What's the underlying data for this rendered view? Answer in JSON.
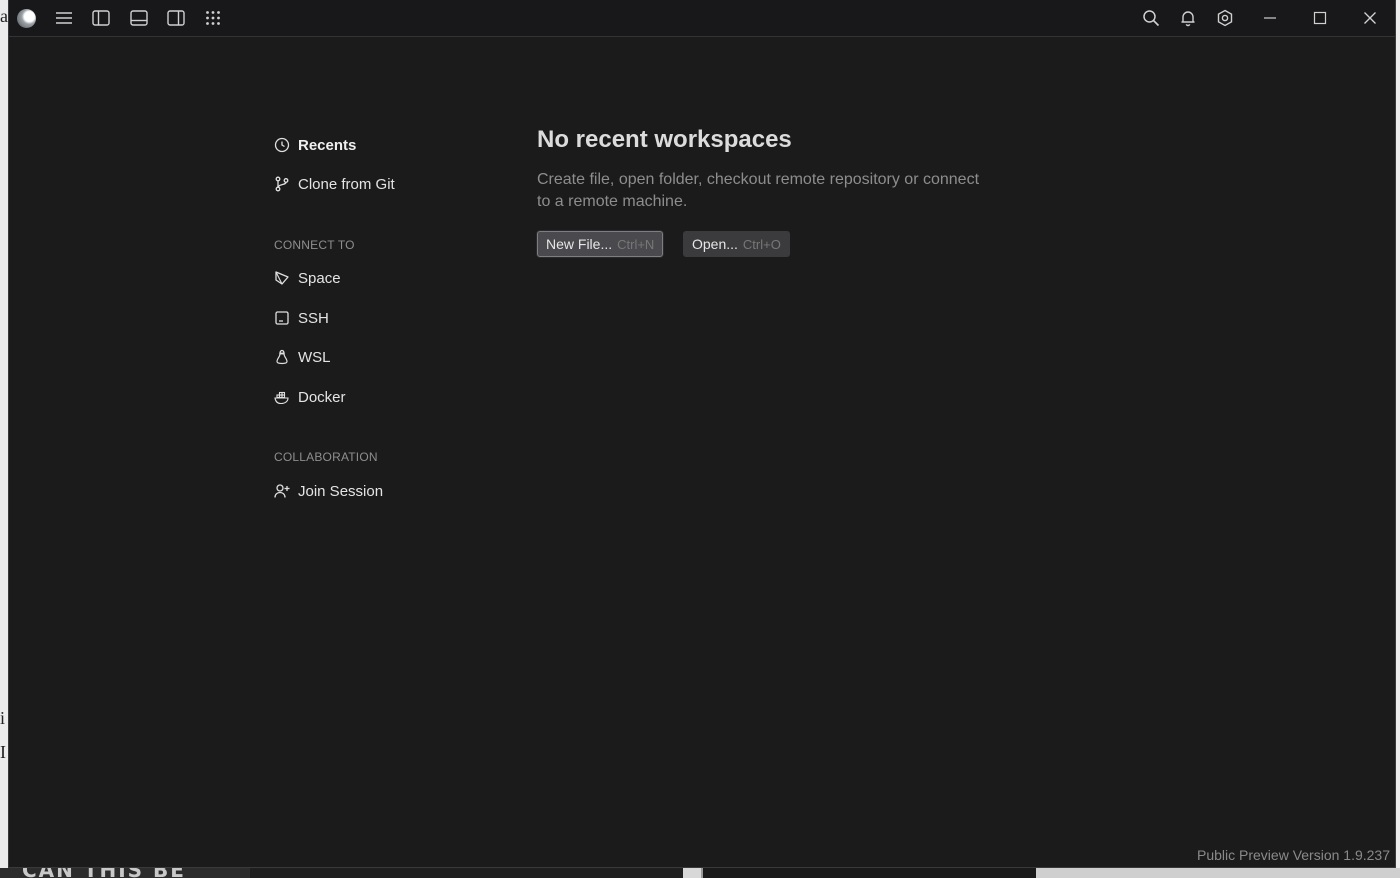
{
  "background": {
    "left_glyphs": [
      "a",
      "i",
      "I"
    ],
    "banner_text": "CAN THIS BE"
  },
  "titlebar": {
    "icons": [
      "app-logo",
      "menu-icon",
      "toggle-left-panel-icon",
      "toggle-bottom-panel-icon",
      "toggle-right-panel-icon",
      "apps-grid-icon",
      "search-icon",
      "bell-icon",
      "settings-icon",
      "minimize-icon",
      "maximize-icon",
      "close-icon"
    ]
  },
  "sidebar": {
    "recents": "Recents",
    "clone": "Clone from Git",
    "connect_heading": "CONNECT TO",
    "connect_items": [
      "Space",
      "SSH",
      "WSL",
      "Docker"
    ],
    "collab_heading": "COLLABORATION",
    "join": "Join Session"
  },
  "main": {
    "title": "No recent workspaces",
    "description": "Create file, open folder, checkout remote repository or connect to a remote machine.",
    "new_file_label": "New File...",
    "new_file_shortcut": "Ctrl+N",
    "open_label": "Open...",
    "open_shortcut": "Ctrl+O"
  },
  "footer": {
    "version": "Public Preview Version 1.9.237"
  },
  "colors": {
    "window_bg": "#1b1b1c",
    "titlebar_bg": "#18181a",
    "text_primary": "#e4e4e4",
    "text_muted": "#8d8d8d",
    "button_bg": "#4a4a4e"
  }
}
